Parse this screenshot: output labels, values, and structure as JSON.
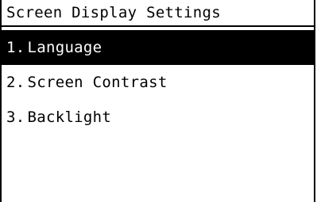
{
  "screen": {
    "title": "Screen Display Settings",
    "items": [
      {
        "number": "1.",
        "label": "Language",
        "selected": true
      },
      {
        "number": "2.",
        "label": "Screen Contrast",
        "selected": false
      },
      {
        "number": "3.",
        "label": "Backlight",
        "selected": false
      }
    ]
  },
  "colors": {
    "background": "#ffffff",
    "foreground": "#000000",
    "highlight": "#000000",
    "highlight_text": "#ffffff"
  }
}
